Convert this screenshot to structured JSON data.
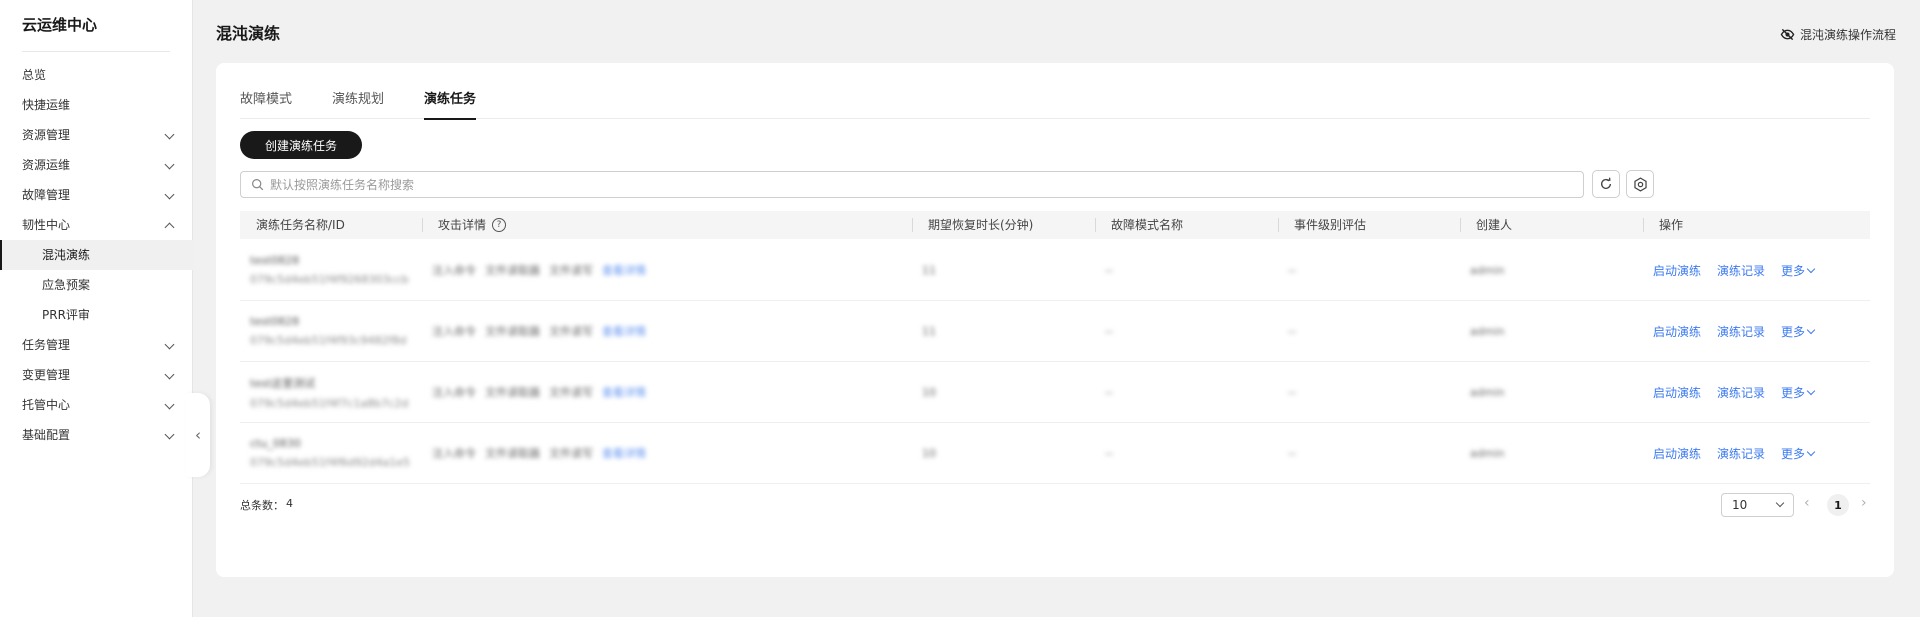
{
  "sidebar": {
    "title": "云运维中心",
    "items": [
      {
        "label": "总览"
      },
      {
        "label": "快捷运维"
      },
      {
        "label": "资源管理"
      },
      {
        "label": "资源运维"
      },
      {
        "label": "故障管理"
      },
      {
        "label": "韧性中心"
      },
      {
        "label": "混沌演练"
      },
      {
        "label": "应急预案"
      },
      {
        "label": "PRR评审"
      },
      {
        "label": "任务管理"
      },
      {
        "label": "变更管理"
      },
      {
        "label": "托管中心"
      },
      {
        "label": "基础配置"
      }
    ],
    "collapse_glyph": "‹"
  },
  "header": {
    "title": "混沌演练",
    "flow_link": "混沌演练操作流程"
  },
  "tabs": [
    {
      "label": "故障模式"
    },
    {
      "label": "演练规划"
    },
    {
      "label": "演练任务"
    }
  ],
  "toolbar": {
    "create_label": "创建演练任务",
    "search_placeholder": "默认按照演练任务名称搜索"
  },
  "table": {
    "columns": [
      {
        "label": "演练任务名称/ID"
      },
      {
        "label": "攻击详情"
      },
      {
        "label": "期望恢复时长(分钟)"
      },
      {
        "label": "故障模式名称"
      },
      {
        "label": "事件级别评估"
      },
      {
        "label": "创建人"
      },
      {
        "label": "操作"
      }
    ],
    "help_glyph": "?",
    "rows": [
      {
        "name": "test0828",
        "id": "079c5d4eb51f4f9268303ccb",
        "attack": [
          "注入命令",
          "文件读取器",
          "文件读写"
        ],
        "attack_link": "查看详情",
        "duration": "11",
        "fault": "--",
        "level": "--",
        "creator": "admin"
      },
      {
        "name": "test0828",
        "id": "079c5d4eb51f4f93c9482f8d",
        "attack": [
          "注入命令",
          "文件读取器",
          "文件读写"
        ],
        "attack_link": "查看详情",
        "duration": "11",
        "fault": "--",
        "level": "--",
        "creator": "admin"
      },
      {
        "name": "test这里测试",
        "id": "079c5d4eb51f4f7c1a8b7c2d",
        "attack": [
          "注入命令",
          "文件读取器",
          "文件读写"
        ],
        "attack_link": "查看详情",
        "duration": "10",
        "fault": "--",
        "level": "--",
        "creator": "admin"
      },
      {
        "name": "ctu_0830",
        "id": "079c5d4eb51f4f6d92d4a1e5",
        "attack": [
          "注入命令",
          "文件读取器",
          "文件读写"
        ],
        "attack_link": "查看详情",
        "duration": "10",
        "fault": "--",
        "level": "--",
        "creator": "admin"
      }
    ],
    "actions": {
      "start": "启动演练",
      "record": "演练记录",
      "more": "更多"
    }
  },
  "pagination": {
    "total_label": "总条数：",
    "total": "4",
    "page_size": "10",
    "current_page": "1",
    "prev_glyph": "‹",
    "next_glyph": "›"
  }
}
